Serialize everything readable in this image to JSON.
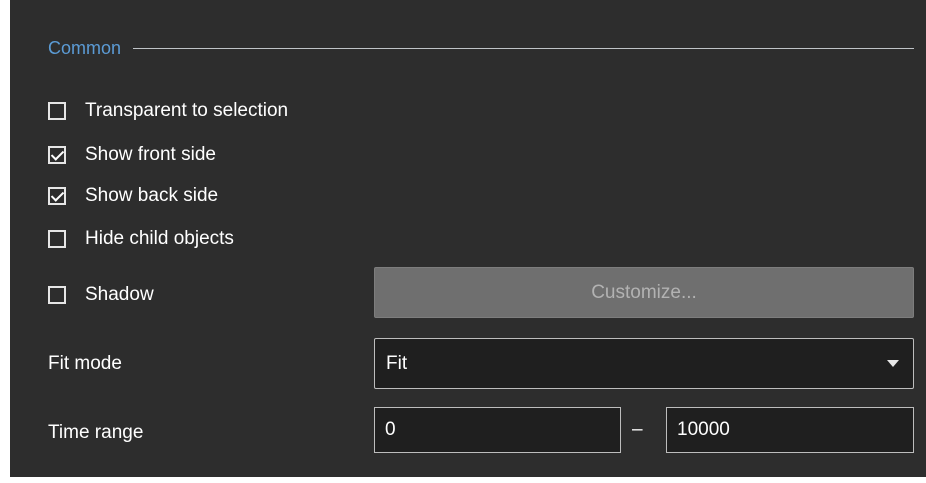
{
  "section": {
    "title": "Common"
  },
  "options": [
    {
      "label": "Transparent to selection",
      "checked": false
    },
    {
      "label": "Show front side",
      "checked": true
    },
    {
      "label": "Show back side",
      "checked": true
    },
    {
      "label": "Hide child objects",
      "checked": false
    }
  ],
  "shadow": {
    "label": "Shadow",
    "checked": false,
    "customize_label": "Customize..."
  },
  "fit_mode": {
    "label": "Fit mode",
    "value": "Fit"
  },
  "time_range": {
    "label": "Time range",
    "from": "0",
    "separator": "–",
    "to": "10000"
  },
  "colors": {
    "background": "#2d2d2d",
    "section_title": "#5b9bd5",
    "field_background": "#1f1f1f",
    "disabled_button": "#6f6f6f"
  },
  "icons": {
    "checkbox": "checkbox-icon",
    "dropdown": "chevron-down-icon"
  }
}
